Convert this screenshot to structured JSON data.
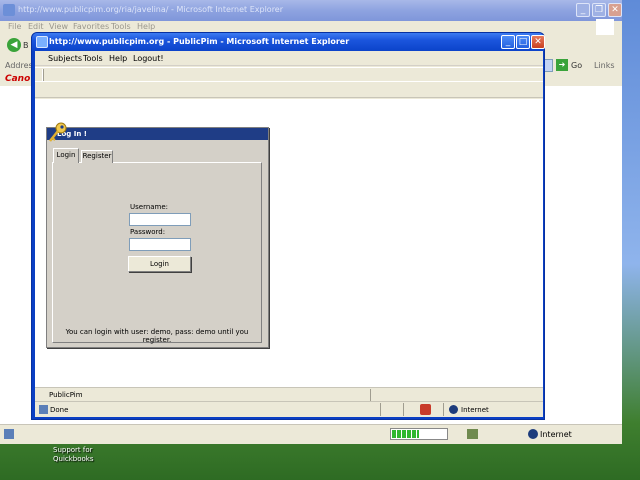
{
  "background_window": {
    "title": "http://www.publicpim.org/ria/javelina/ - Microsoft Internet Explorer",
    "menu": [
      "File",
      "Edit",
      "View",
      "Favorites",
      "Tools",
      "Help"
    ],
    "back_label": "B",
    "address_label": "Address",
    "go_label": "Go",
    "links_label": "Links",
    "logo_text": "Cano",
    "status_zone": "Internet",
    "progress_fraction": 0.5
  },
  "desktop": {
    "icon_label": "Support for Quickbooks"
  },
  "window": {
    "title": "http://www.publicpim.org - PublicPim - Microsoft Internet Explorer",
    "menu": [
      "Subjects",
      "Tools",
      "Help",
      "Logout!"
    ],
    "app_status": "PublicPim",
    "status_text": "Done",
    "status_zone": "Internet"
  },
  "login": {
    "title": "Log In !",
    "tabs": [
      "Login",
      "Register"
    ],
    "active_tab": "Login",
    "username_label": "Username:",
    "username_value": "",
    "password_label": "Password:",
    "password_value": "",
    "button_label": "Login",
    "hint": "You can login with user: demo, pass: demo until you register."
  },
  "colors": {
    "active_title": "#0b43c9",
    "dialog_title": "#1f3d86",
    "chrome": "#ece9d8",
    "panel": "#d4d0c8"
  }
}
